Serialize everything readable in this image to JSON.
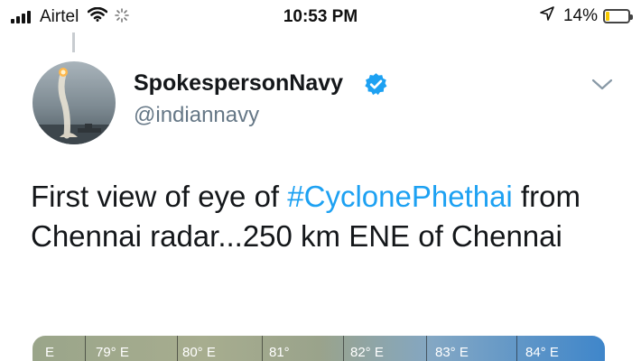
{
  "status_bar": {
    "carrier": "Airtel",
    "time": "10:53 PM",
    "battery_percent": "14%",
    "battery_level": 0.14,
    "icons": [
      "signal-icon",
      "wifi-icon",
      "loading-icon",
      "location-arrow-icon",
      "battery-icon"
    ]
  },
  "tweet": {
    "display_name": "SpokespersonNavy",
    "handle": "@indiannavy",
    "verified": true,
    "text_before": "First view of eye of ",
    "hashtag": "#CyclonePhethai",
    "text_after": " from Chennai radar...250 km ENE of Chennai"
  },
  "media": {
    "tick_labels": [
      "E",
      "79° E",
      "80° E",
      "81°",
      "82° E",
      "83° E",
      "84° E"
    ]
  },
  "colors": {
    "link": "#1da1f2",
    "verified": "#1da1f2",
    "handle": "#657786",
    "battery_fill": "#f5c800"
  }
}
